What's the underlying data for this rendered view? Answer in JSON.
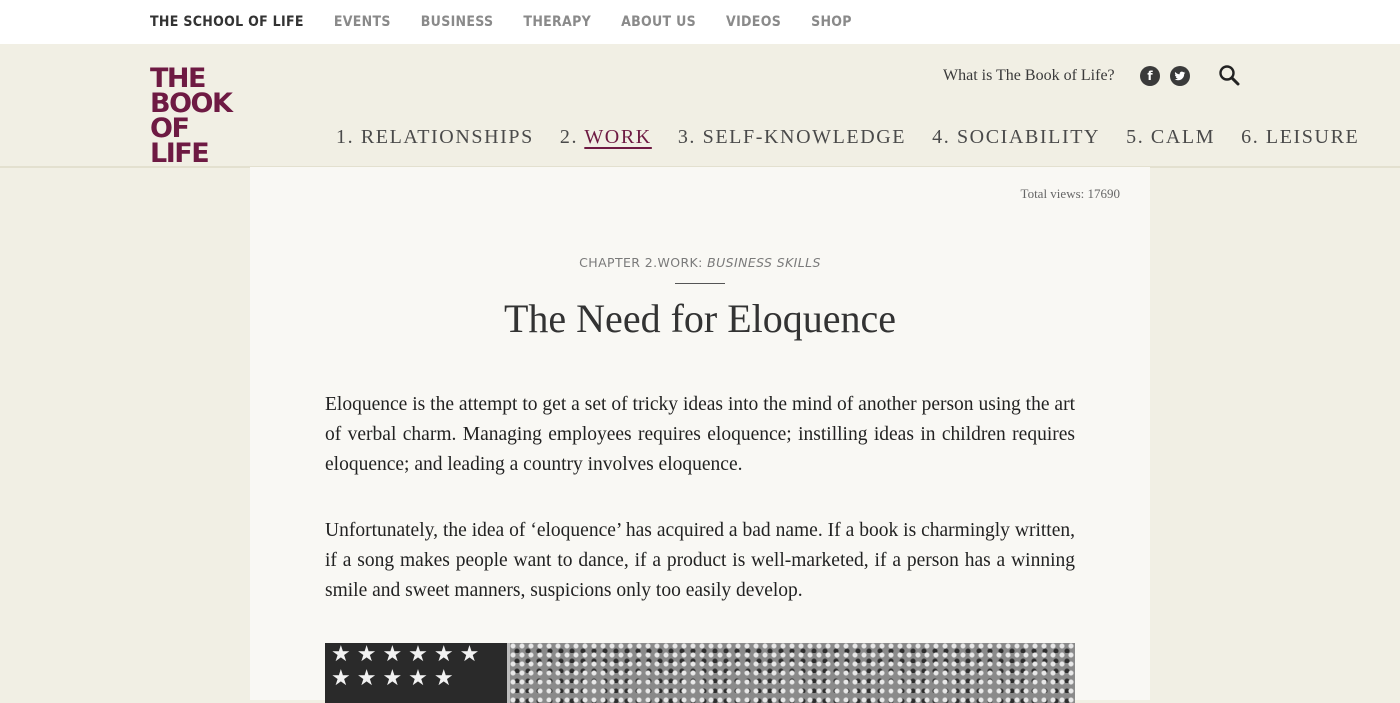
{
  "topnav": {
    "items": [
      "The School of Life",
      "Events",
      "Business",
      "Therapy",
      "About Us",
      "Videos",
      "Shop"
    ]
  },
  "header": {
    "logo_lines": [
      "THE",
      "BOOK",
      "OF LIFE"
    ],
    "what_is": "What is The Book of Life?",
    "social": [
      {
        "icon": "facebook-icon",
        "glyph": "f"
      },
      {
        "icon": "twitter-icon",
        "glyph": "t"
      }
    ],
    "search_icon": "search-icon",
    "nav": [
      {
        "num": "1.",
        "label": "Relationships"
      },
      {
        "num": "2.",
        "label": "Work"
      },
      {
        "num": "3.",
        "label": "Self-Knowledge"
      },
      {
        "num": "4.",
        "label": "Sociability"
      },
      {
        "num": "5.",
        "label": "Calm"
      },
      {
        "num": "6.",
        "label": "Leisure"
      }
    ],
    "active_nav_index": 1
  },
  "article": {
    "total_views": "Total views: 17690",
    "chapter": "CHAPTER 2.WORK:",
    "category": "BUSINESS SKILLS",
    "title": "The Need for Eloquence",
    "paragraphs": [
      "Eloquence is the attempt to get a set of tricky ideas into the mind of another person using the art of verbal charm. Managing employees requires eloquence; instilling ideas in children requires eloquence; and leading a country involves eloquence.",
      "Unfortunately, the idea of ‘eloquence’ has acquired a bad name. If a book is charmingly written, if a song makes people want to dance, if a product is well-marketed, if a person has a winning smile and sweet manners, suspicions only too easily develop."
    ],
    "image": {
      "flag_stars": "★★★★★★ ★★★★★"
    }
  },
  "colors": {
    "brand": "#6e1a43",
    "background": "#f1efe4",
    "card": "#f9f8f4"
  }
}
